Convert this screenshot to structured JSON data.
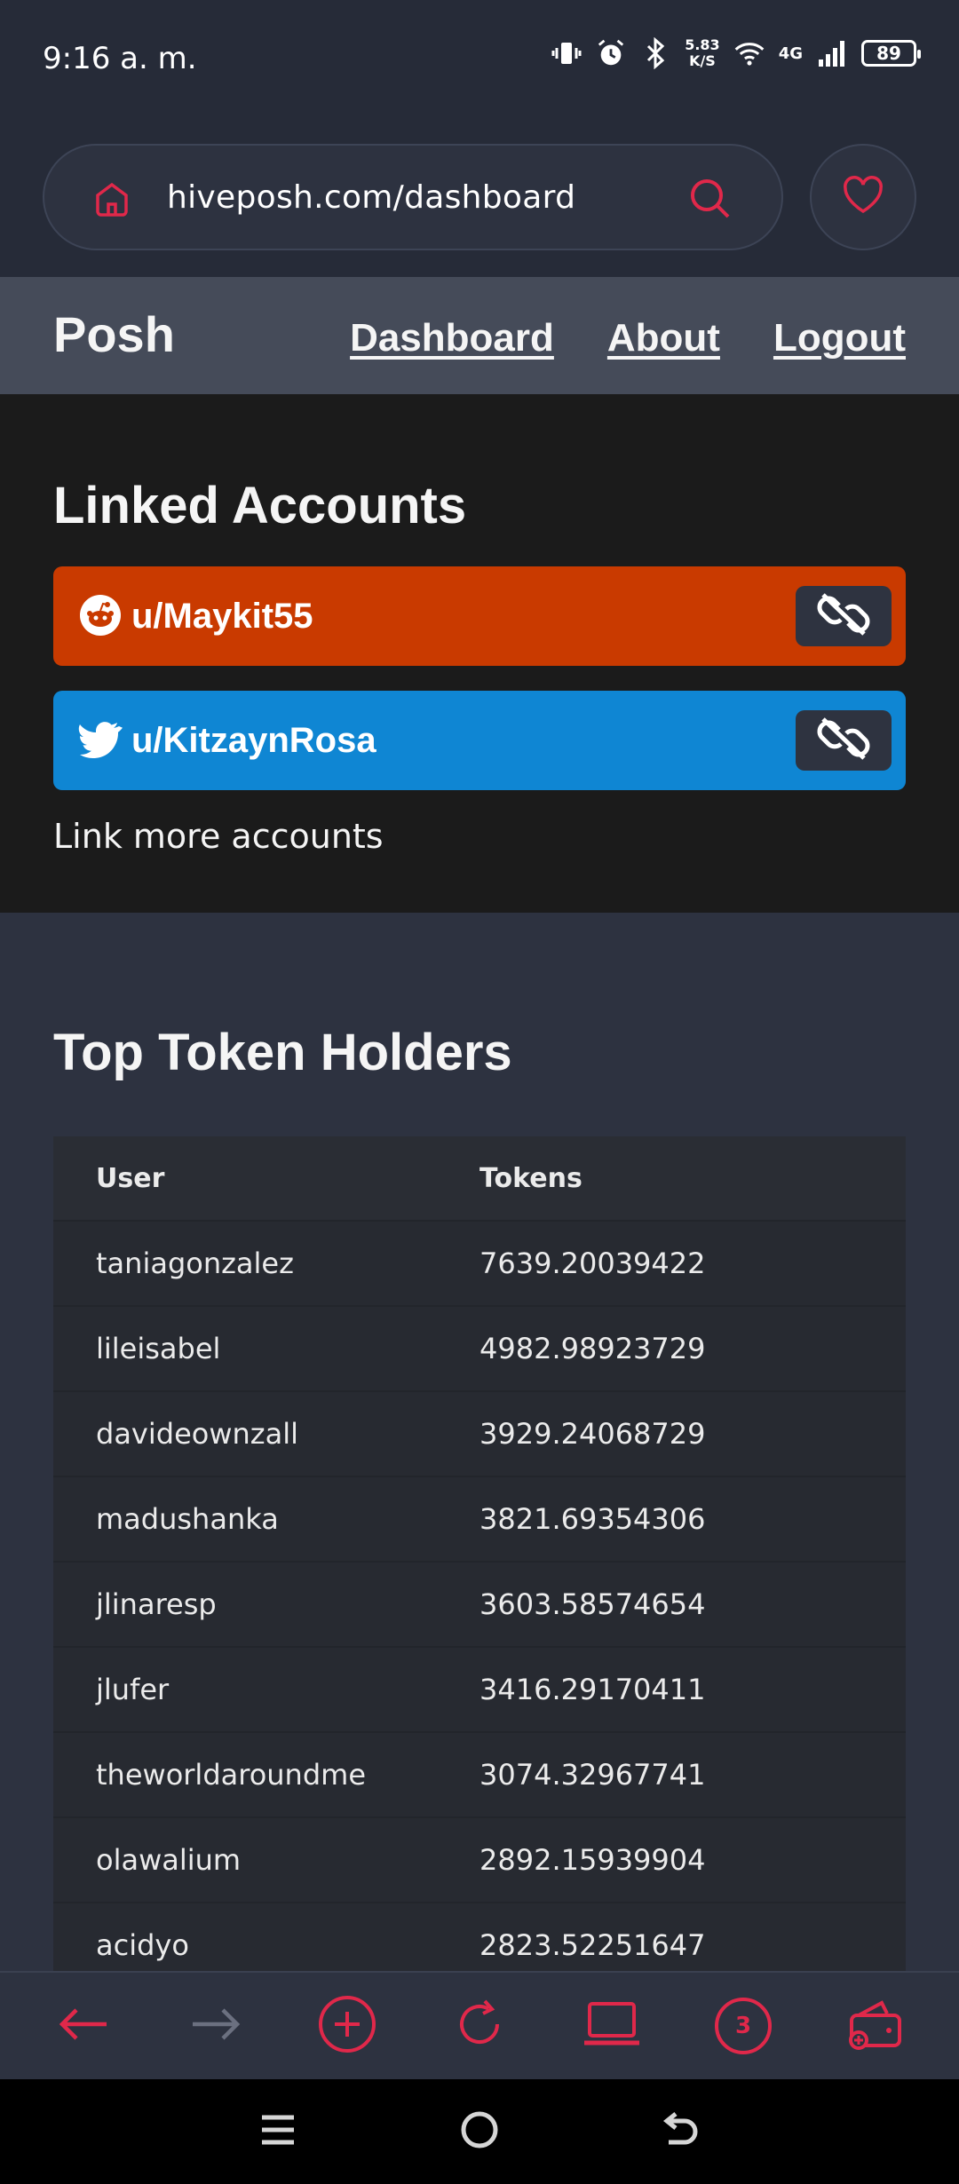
{
  "status": {
    "time": "9:16 a. m.",
    "speed_value": "5.83",
    "speed_unit": "K/S",
    "network": "4G",
    "battery": "89"
  },
  "browser": {
    "url": "hiveposh.com/dashboard",
    "tab_count": "3"
  },
  "nav": {
    "brand": "Posh",
    "links": [
      "Dashboard",
      "About",
      "Logout"
    ]
  },
  "linked_accounts": {
    "title": "Linked Accounts",
    "accounts": [
      {
        "name": "u/Maykit55",
        "icon": "reddit-icon"
      },
      {
        "name": "u/KitzaynRosa",
        "icon": "twitter-icon"
      }
    ],
    "link_more": "Link more accounts"
  },
  "holders": {
    "title": "Top Token Holders",
    "columns": [
      "User",
      "Tokens"
    ],
    "rows": [
      [
        "taniagonzalez",
        "7639.20039422"
      ],
      [
        "lileisabel",
        "4982.98923729"
      ],
      [
        "davideownzall",
        "3929.24068729"
      ],
      [
        "madushanka",
        "3821.69354306"
      ],
      [
        "jlinaresp",
        "3603.58574654"
      ],
      [
        "jlufer",
        "3416.29170411"
      ],
      [
        "theworldaroundme",
        "3074.32967741"
      ],
      [
        "olawalium",
        "2892.15939904"
      ],
      [
        "acidyo",
        "2823.52251647"
      ]
    ]
  },
  "colors": {
    "accent": "#e0284a",
    "reddit": "#c93a00",
    "twitter": "#0f86d3",
    "nav_bg": "#454b59"
  }
}
